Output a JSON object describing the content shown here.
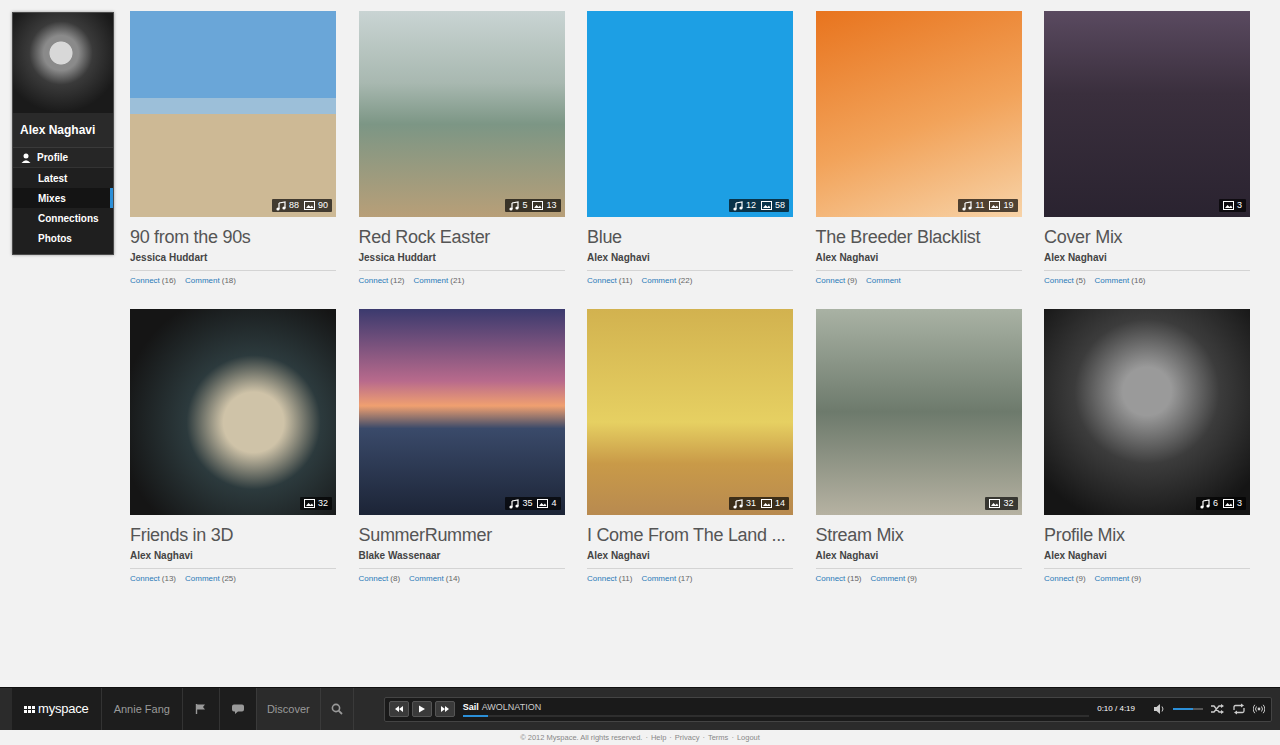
{
  "profile": {
    "name": "Alex Naghavi",
    "nav": [
      {
        "label": "Profile",
        "kind": "header",
        "selected": false
      },
      {
        "label": "Latest",
        "kind": "link",
        "selected": false
      },
      {
        "label": "Mixes",
        "kind": "link",
        "selected": true
      },
      {
        "label": "Connections",
        "kind": "link",
        "selected": false
      },
      {
        "label": "Photos",
        "kind": "link",
        "selected": false
      }
    ]
  },
  "mixes": [
    {
      "title": "90 from the 90s",
      "author": "Jessica Huddart",
      "songs": "88",
      "photos": "90",
      "connect": "Connect",
      "connect_count": "(16)",
      "comment": "Comment",
      "comment_count": "(18)"
    },
    {
      "title": "Red Rock Easter",
      "author": "Jessica Huddart",
      "songs": "5",
      "photos": "13",
      "connect": "Connect",
      "connect_count": "(12)",
      "comment": "Comment",
      "comment_count": "(21)"
    },
    {
      "title": "Blue",
      "author": "Alex Naghavi",
      "songs": "12",
      "photos": "58",
      "connect": "Connect",
      "connect_count": "(11)",
      "comment": "Comment",
      "comment_count": "(22)"
    },
    {
      "title": "The Breeder Blacklist",
      "author": "Alex Naghavi",
      "songs": "11",
      "photos": "19",
      "connect": "Connect",
      "connect_count": "(9)",
      "comment": "Comment"
    },
    {
      "title": "Cover Mix",
      "author": "Alex Naghavi",
      "photos": "3",
      "connect": "Connect",
      "connect_count": "(5)",
      "comment": "Comment",
      "comment_count": "(16)"
    },
    {
      "title": "Friends in 3D",
      "author": "Alex Naghavi",
      "photos": "32",
      "connect": "Connect",
      "connect_count": "(13)",
      "comment": "Comment",
      "comment_count": "(25)"
    },
    {
      "title": "SummerRummer",
      "author": "Blake Wassenaar",
      "songs": "35",
      "photos": "4",
      "connect": "Connect",
      "connect_count": "(8)",
      "comment": "Comment",
      "comment_count": "(14)"
    },
    {
      "title": "I Come From The Land ...",
      "author": "Alex Naghavi",
      "songs": "31",
      "photos": "14",
      "connect": "Connect",
      "connect_count": "(11)",
      "comment": "Comment",
      "comment_count": "(17)"
    },
    {
      "title": "Stream Mix",
      "author": "Alex Naghavi",
      "photos": "32",
      "connect": "Connect",
      "connect_count": "(15)",
      "comment": "Comment",
      "comment_count": "(9)"
    },
    {
      "title": "Profile Mix",
      "author": "Alex Naghavi",
      "songs": "6",
      "photos": "3",
      "connect": "Connect",
      "connect_count": "(9)",
      "comment": "Comment",
      "comment_count": "(9)"
    }
  ],
  "bar": {
    "logo": "myspace",
    "user": "Annie Fang",
    "discover": "Discover"
  },
  "player": {
    "track": "Sail",
    "artist": "AWOLNATION",
    "time": "0:10 / 4:19",
    "progress": 0.04,
    "volume": 0.65
  },
  "footer": {
    "copyright": "© 2012 Myspace. All rights reserved.",
    "separator": "·",
    "links": [
      "Help",
      "Privacy",
      "Terms",
      "Logout"
    ]
  }
}
